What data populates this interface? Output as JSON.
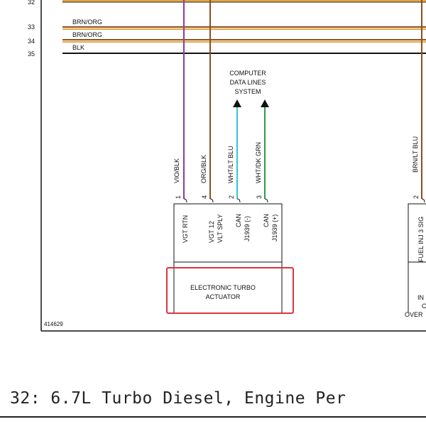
{
  "wires": {
    "row_numbers": [
      "32",
      "33",
      "34",
      "35"
    ],
    "labels": {
      "row33": "BRN/ORG",
      "row34": "BRN/ORG",
      "row35": "BLK",
      "vio_blk": "VIO/BLK",
      "org_blk": "ORG/BLK",
      "wht_lt_blu": "WHT/LT BLU",
      "wht_dk_grn": "WHT/DK GRN",
      "brn_lt_blu": "BRN/LT BLU"
    },
    "colors": {
      "violet": "#8a3c9c",
      "brown": "#8a4f1e",
      "cyan": "#34c4d4",
      "green": "#2e9c48",
      "orange": "#e8a33a",
      "black": "#111111"
    }
  },
  "data_lines": {
    "line1": "COMPUTER",
    "line2": "DATA LINES",
    "line3": "SYSTEM"
  },
  "actuator": {
    "pins": [
      "1",
      "4",
      "2",
      "3"
    ],
    "pin_labels": {
      "p1": "VGT RTN",
      "p4a": "VGT 12",
      "p4b": "VLT SPLY",
      "p2a": "CAN",
      "p2b": "J1939 (-)",
      "p3a": "CAN",
      "p3b": "J1939 (+)"
    },
    "name_line1": "ELECTRONIC TURBO",
    "name_line2": "ACTUATOR",
    "highlight_color": "#d9363e"
  },
  "right_component": {
    "pin": "2",
    "pin_label": "FUEL INJ 3 SIG",
    "label_line1": "IN",
    "label_line2": "C",
    "label_line3": "OVER"
  },
  "figure_id": "414629",
  "caption": "32: 6.7L Turbo Diesel, Engine Per"
}
